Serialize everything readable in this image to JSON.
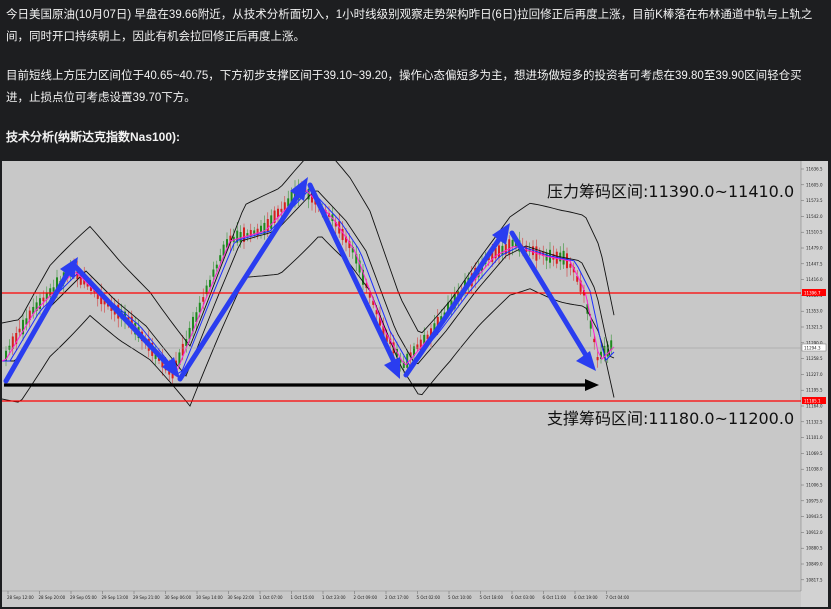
{
  "article": {
    "paragraph1": "今日美国原油(10月07日) 早盘在39.66附近，从技术分析面切入，1小时线级别观察走势架构昨日(6日)拉回修正后再度上涨，目前K棒落在布林通道中轨与上轨之间，同时开口持续朝上，因此有机会拉回修正后再度上涨。",
    "paragraph2": "目前短线上方压力区间位于40.65~40.75，下方初步支撑区间于39.10~39.20，操作心态偏短多为主，想进场做短多的投资者可考虑在39.80至39.90区间轻仓买进，止损点位可考虑设置39.70下方。",
    "heading": "技术分析(纳斯达克指数Nas100):"
  },
  "chart": {
    "resistance_label": "压力筹码区间:11390.0~11410.0",
    "support_label": "支撑筹码区间:11180.0~11200.0",
    "price_ticks": [
      "11636.5",
      "11605.0",
      "11573.5",
      "11542.0",
      "11510.5",
      "11479.0",
      "11447.5",
      "11416.0",
      "11384.5",
      "11353.0",
      "11321.5",
      "11290.0",
      "11258.5",
      "11227.0",
      "11195.5",
      "11164.0",
      "11132.5",
      "11101.0",
      "11069.5",
      "11038.0",
      "11006.5",
      "10975.0",
      "10943.5",
      "10912.0",
      "10880.5",
      "10849.0",
      "10817.5"
    ],
    "price_tag_current": "11294.3",
    "price_tag_resistance": "11396.7",
    "price_tag_support": "11185.1",
    "time_ticks": [
      "28 Sep 12:00",
      "28 Sep 20:00",
      "29 Sep 05:00",
      "29 Sep 13:00",
      "29 Sep 21:00",
      "30 Sep 06:00",
      "30 Sep 14:00",
      "30 Sep 22:00",
      "1 Oct 07:00",
      "1 Oct 15:00",
      "1 Oct 23:00",
      "2 Oct 09:00",
      "2 Oct 17:00",
      "5 Oct 02:00",
      "5 Oct 10:00",
      "5 Oct 18:00",
      "6 Oct 03:00",
      "6 Oct 11:00",
      "6 Oct 19:00",
      "7 Oct 04:00"
    ],
    "colors": {
      "background": "#c8c8c8",
      "arrow": "#2a3df0",
      "level_line": "#ff0000",
      "support_arrow": "#000000",
      "candle_up": "#1e8a1e",
      "candle_down": "#d81f1f",
      "band": "#111111",
      "ma_fast": "#ff1fd6",
      "ma_mid": "#1a2bff"
    }
  }
}
